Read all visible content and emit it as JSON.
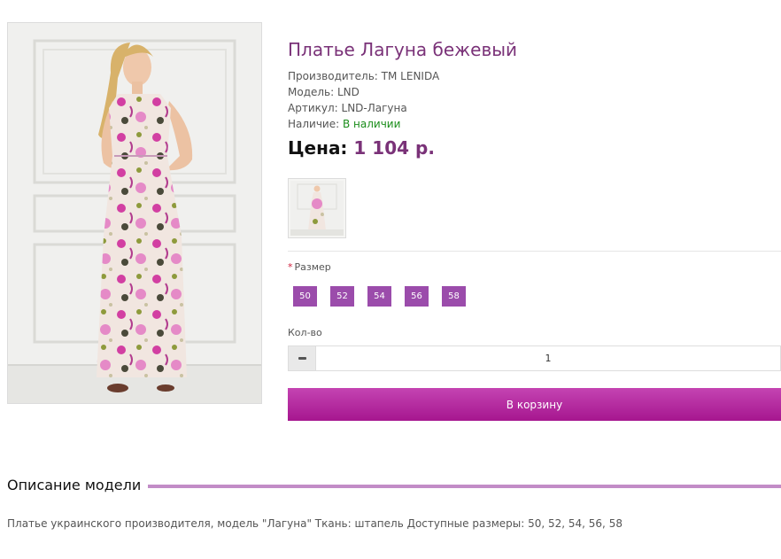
{
  "product": {
    "title": "Платье Лагуна бежевый",
    "manufacturer_label": "Производитель:",
    "manufacturer_value": "TM LENIDA",
    "model_label": "Модель:",
    "model_value": "LND",
    "article_label": "Артикул:",
    "article_value": "LND-Лагуна",
    "availability_label": "Наличие:",
    "availability_value": "В наличии",
    "price_label": "Цена:",
    "price_value": "1 104 р."
  },
  "options": {
    "required_mark": "*",
    "size_label": "Размер",
    "sizes": [
      "50",
      "52",
      "54",
      "56",
      "58"
    ],
    "quantity_label": "Кол-во",
    "quantity_value": "1"
  },
  "actions": {
    "add_to_cart": "В корзину"
  },
  "description": {
    "heading": "Описание модели",
    "text": "Платье украинского производителя, модель \"Лагуна\" Ткань: штапель Доступные размеры: 50, 52, 54, 56, 58"
  },
  "colors": {
    "accent_purple": "#7a3278",
    "size_button": "#9b4cab",
    "cart_button": "#b32a9f",
    "in_stock_green": "#1a8d1a",
    "heading_rule": "#c28cc7"
  },
  "icons": {
    "quantity_decrease": "minus-icon"
  }
}
